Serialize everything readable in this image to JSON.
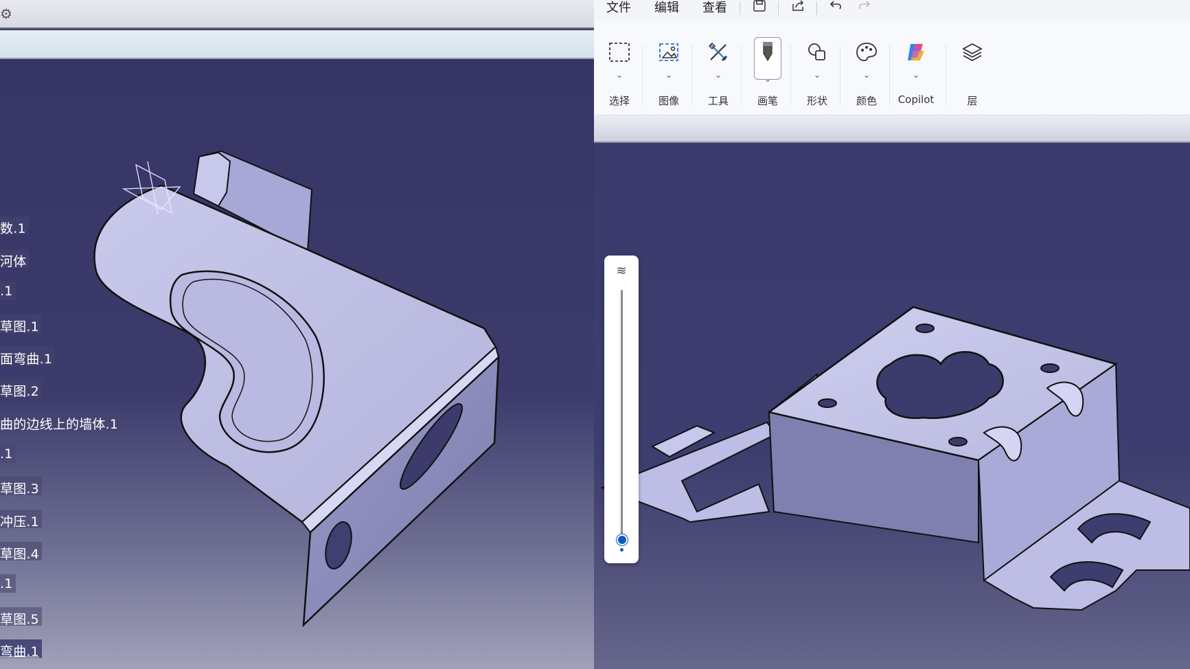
{
  "spec_tree": {
    "items": [
      {
        "label": "数.1"
      },
      {
        "label": "河体"
      },
      {
        "label": ".1"
      },
      {
        "label": "草图.1"
      },
      {
        "label": "面弯曲.1"
      },
      {
        "label": "草图.2"
      },
      {
        "label": "曲的边线上的墙体.1"
      },
      {
        "label": ".1"
      },
      {
        "label": "草图.3"
      },
      {
        "label": "冲压.1"
      },
      {
        "label": "草图.4"
      },
      {
        "label": ".1"
      },
      {
        "label": "草图.5"
      },
      {
        "label": "弯曲.1"
      }
    ]
  },
  "paint": {
    "menu": {
      "file": "文件",
      "edit": "编辑",
      "view": "查看"
    },
    "quick_access": [
      "save-icon",
      "share-icon",
      "undo-icon",
      "redo-icon"
    ],
    "ribbon": {
      "select": {
        "label": "选择",
        "icon": "select-rectangle-icon"
      },
      "image": {
        "label": "图像",
        "icon": "image-icon"
      },
      "tools": {
        "label": "工具",
        "icon": "tools-icon"
      },
      "brushes": {
        "label": "画笔",
        "icon": "brush-icon"
      },
      "shapes": {
        "label": "形状",
        "icon": "shapes-icon"
      },
      "colors": {
        "label": "颜色",
        "icon": "palette-icon"
      },
      "copilot": {
        "label": "Copilot",
        "icon": "copilot-icon"
      },
      "layers": {
        "label": "层",
        "icon": "layers-icon"
      }
    },
    "brush_size_slider": {
      "icon": "brush-size-icon",
      "level": 0.05
    },
    "accent_color": "#0b5cc0"
  }
}
